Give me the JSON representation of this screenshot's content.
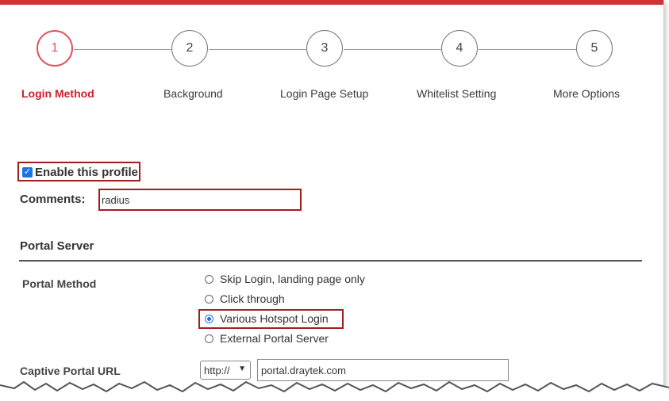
{
  "colors": {
    "accent": "#cf3437",
    "active_step": "#e05561",
    "highlight": "#a01d22",
    "radio_blue": "#1a73e8"
  },
  "steps": [
    {
      "number": "1",
      "label": "Login Method",
      "active": true
    },
    {
      "number": "2",
      "label": "Background",
      "active": false
    },
    {
      "number": "3",
      "label": "Login Page Setup",
      "active": false
    },
    {
      "number": "4",
      "label": "Whitelist Setting",
      "active": false
    },
    {
      "number": "5",
      "label": "More Options",
      "active": false
    }
  ],
  "profile": {
    "enable_label": "Enable this profile",
    "enabled": true,
    "comments_label": "Comments:",
    "comments_value": "radius"
  },
  "portal_server": {
    "title": "Portal Server",
    "method_label": "Portal Method",
    "options": [
      {
        "label": "Skip Login, landing page only",
        "checked": false
      },
      {
        "label": "Click through",
        "checked": false
      },
      {
        "label": "Various Hotspot Login",
        "checked": true
      },
      {
        "label": "External Portal Server",
        "checked": false
      }
    ],
    "captive_url_label": "Captive Portal URL",
    "protocol_selected": "http://",
    "url_value": "portal.draytek.com"
  }
}
